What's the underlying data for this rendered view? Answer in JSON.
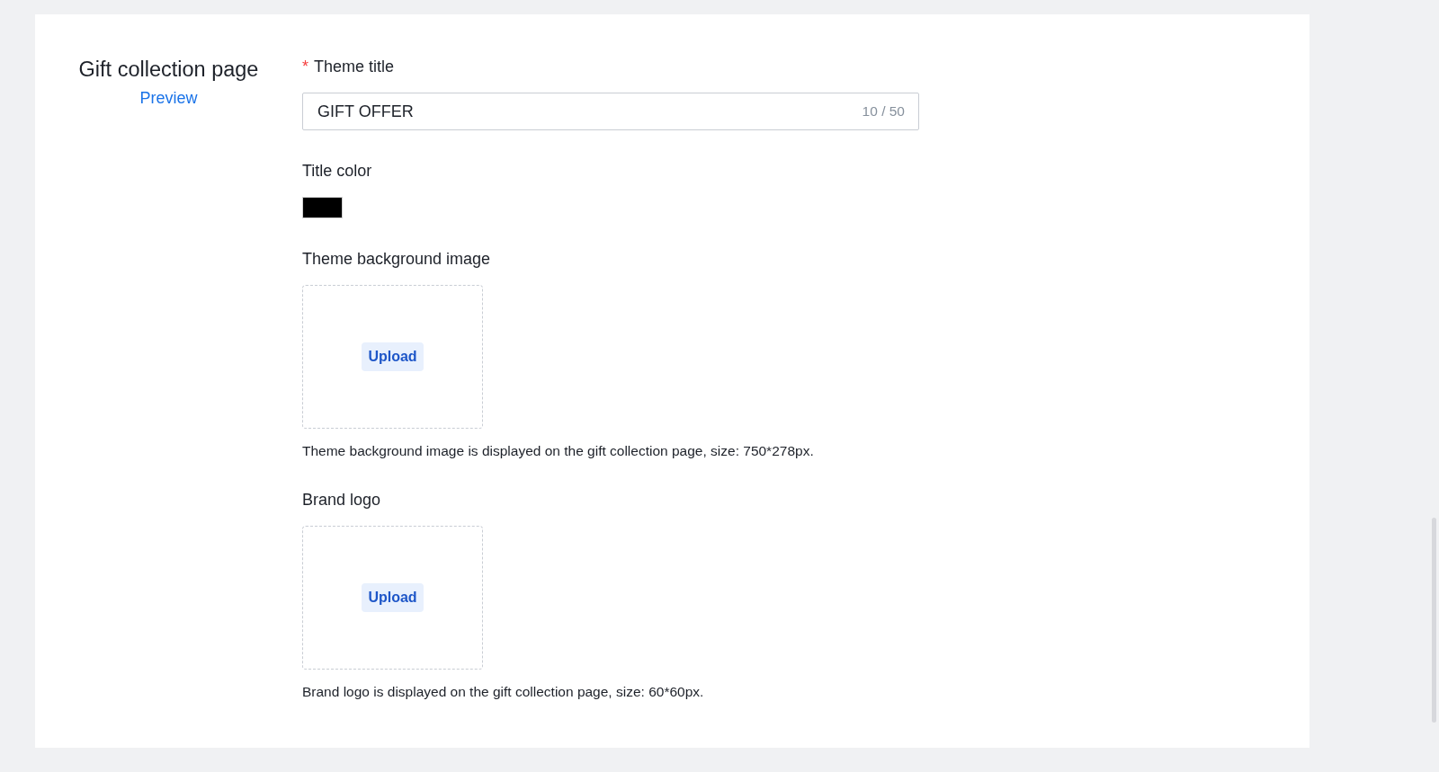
{
  "section": {
    "title": "Gift collection page",
    "link": "Preview"
  },
  "fields": [
    {
      "kind": "text",
      "label": "Theme title",
      "required_mark": "*",
      "value": "GIFT OFFER",
      "counter": "10 / 50"
    },
    {
      "kind": "color",
      "label": "Title color",
      "color": "#000000"
    },
    {
      "kind": "upload",
      "label": "Theme background image",
      "button": "Upload",
      "hint": "Theme background image is displayed on the gift collection page, size: 750*278px."
    },
    {
      "kind": "upload",
      "label": "Brand logo",
      "button": "Upload",
      "hint": "Brand logo is displayed on the gift collection page, size: 60*60px."
    }
  ]
}
